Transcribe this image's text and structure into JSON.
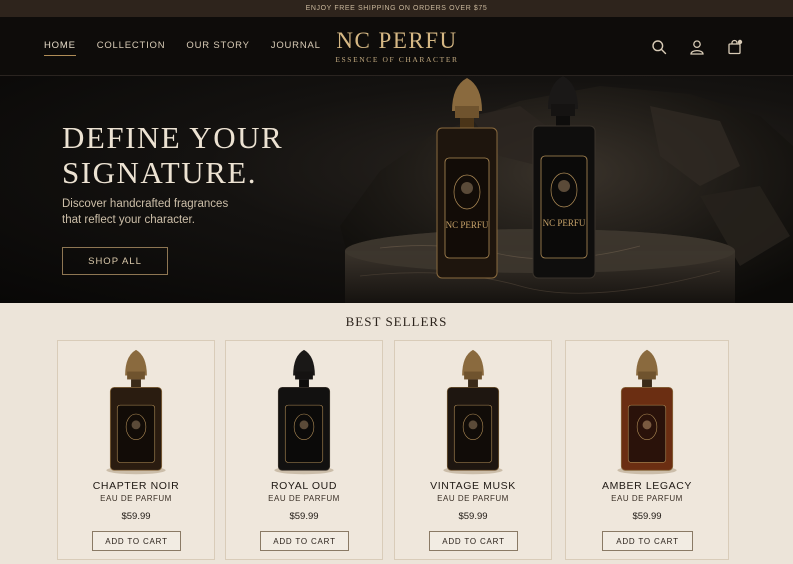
{
  "promo": {
    "text": "ENJOY FREE SHIPPING ON ORDERS OVER $75"
  },
  "nav": {
    "home": "HOME",
    "collection": "COLLECTION",
    "our_story": "OUR STORY",
    "journal": "JOURNAL"
  },
  "brand": {
    "name": "NC PERFU",
    "tagline": "ESSENCE OF CHARACTER"
  },
  "header_icons": [
    "search-icon",
    "account-icon",
    "cart-icon"
  ],
  "hero": {
    "title_line1": "DEFINE YOUR",
    "title_line2": "SIGNATURE.",
    "subtitle_line1": "Discover handcrafted fragrances",
    "subtitle_line2": "that reflect your character.",
    "cta": "SHOP ALL",
    "bottle_label": "NC PERFU"
  },
  "best_sellers": {
    "title": "BEST SELLERS",
    "products": [
      {
        "name": "CHAPTER NOIR",
        "type": "EAU DE PARFUM",
        "price": "$59.99",
        "button": "ADD TO CART",
        "glass_color": "#2a1c10"
      },
      {
        "name": "ROYAL OUD",
        "type": "EAU DE PARFUM",
        "price": "$59.99",
        "button": "ADD TO CART",
        "glass_color": "#121110"
      },
      {
        "name": "VINTAGE MUSK",
        "type": "EAU DE PARFUM",
        "price": "$59.99",
        "button": "ADD TO CART",
        "glass_color": "#1e1610"
      },
      {
        "name": "AMBER LEGACY",
        "type": "EAU DE PARFUM",
        "price": "$59.99",
        "button": "ADD TO CART",
        "glass_color": "#6b2e12"
      }
    ]
  },
  "colors": {
    "accent_gold": "#c9a46a",
    "dark": "#0e0c0a",
    "cream": "#ece4d9"
  }
}
